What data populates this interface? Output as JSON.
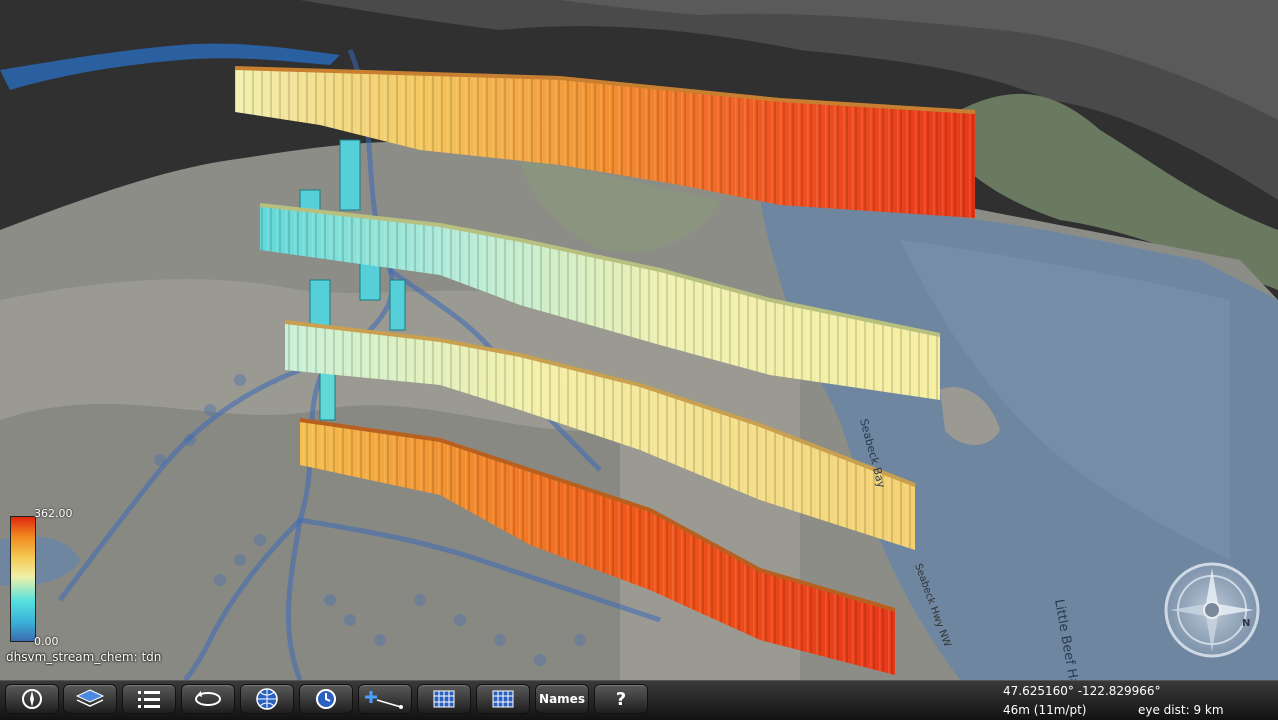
{
  "legend": {
    "max": "362.00",
    "min": "0.00",
    "variable": "dhsvm_stream_chem: tdn"
  },
  "toolbar": {
    "names_label": "Names",
    "help_label": "?"
  },
  "status": {
    "coords": "47.625160°  -122.829966°",
    "elevation": "46m (11m/pt)",
    "eye_dist": "eye dist: 9 km"
  },
  "map_labels": {
    "bay": "Seabeck Bay",
    "harbor": "Little Beef Harbor",
    "highway": "Seabeck Hwy NW"
  },
  "compass": {
    "north_label": "N"
  }
}
